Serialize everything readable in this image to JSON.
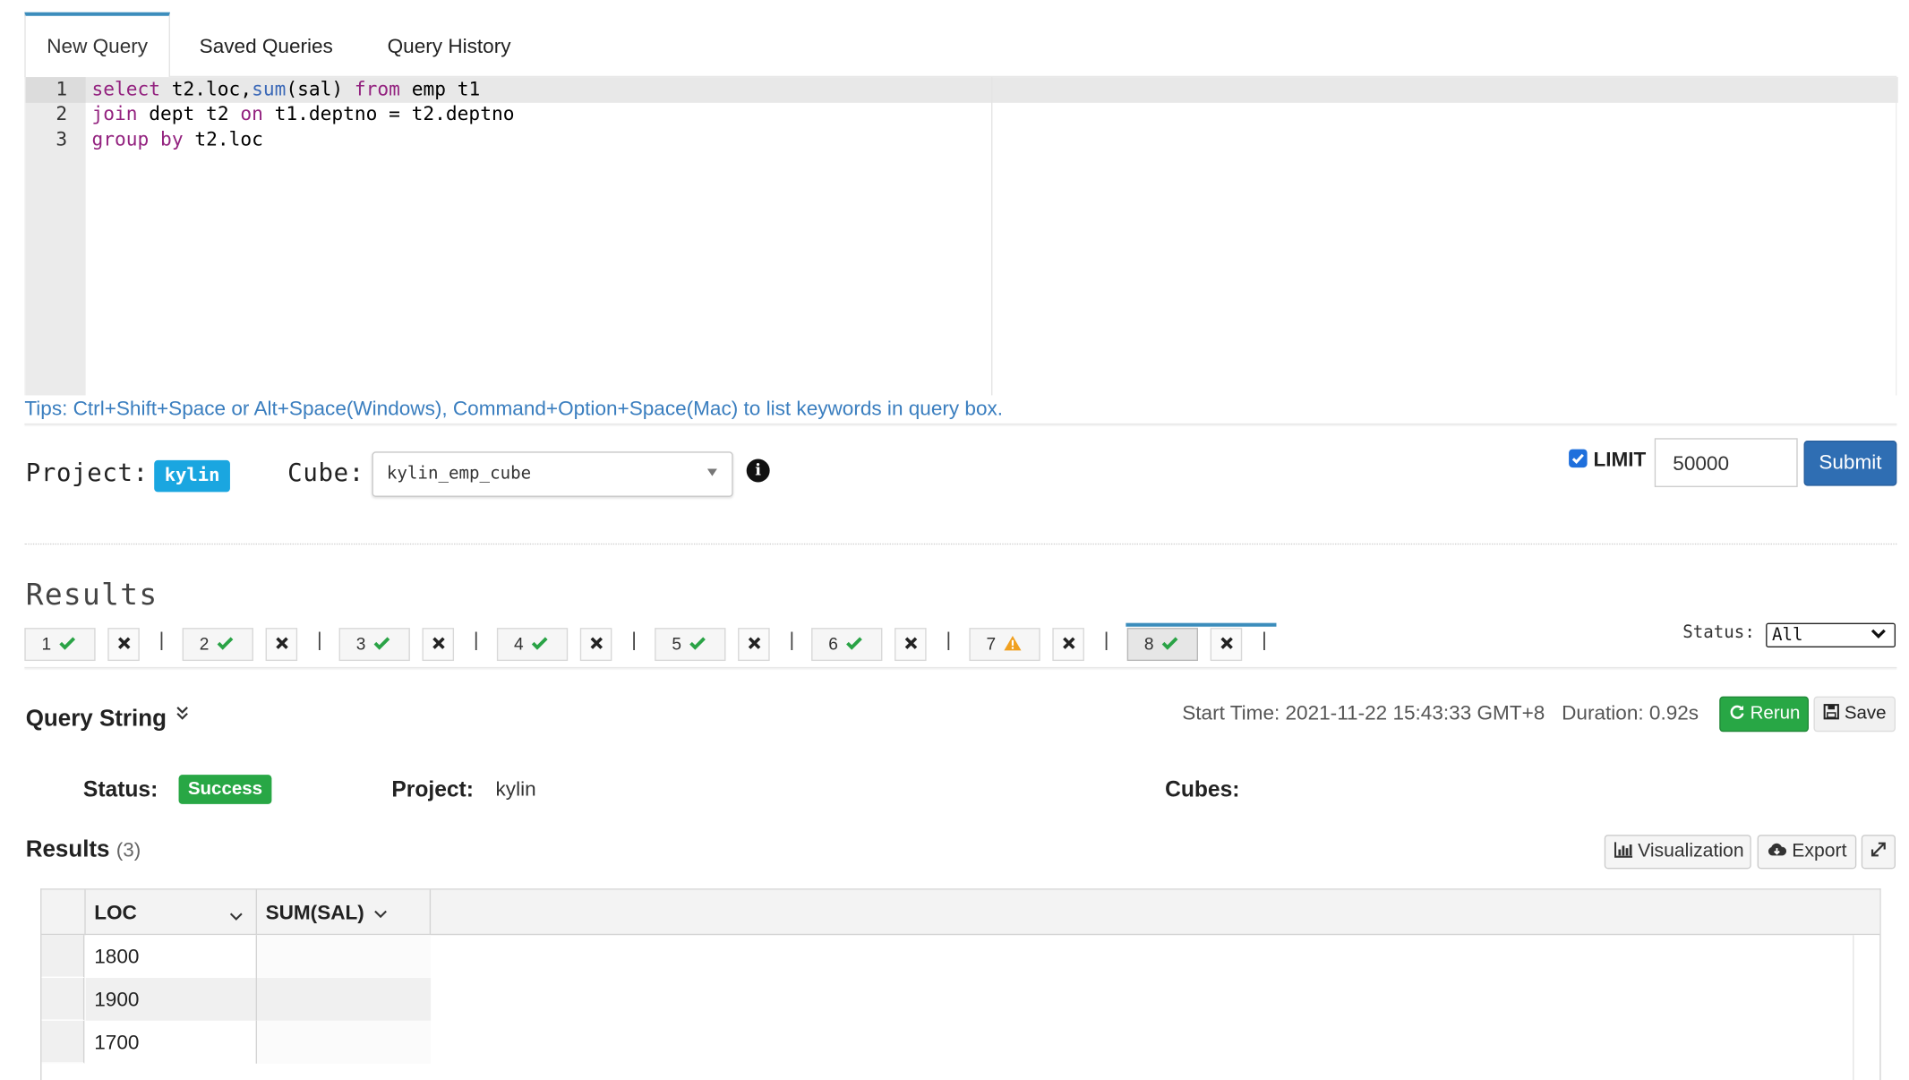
{
  "tabs": [
    {
      "label": "New Query",
      "active": true
    },
    {
      "label": "Saved Queries",
      "active": false
    },
    {
      "label": "Query History",
      "active": false
    }
  ],
  "editor": {
    "line_numbers": [
      "1",
      "2",
      "3"
    ],
    "lines": [
      "select t2.loc,sum(sal) from emp t1",
      "join dept t2 on t1.deptno = t2.deptno",
      "group by t2.loc"
    ]
  },
  "tips": "Tips: Ctrl+Shift+Space or Alt+Space(Windows), Command+Option+Space(Mac) to list keywords in query box.",
  "project_row": {
    "project_label": "Project:",
    "project_value": "kylin",
    "cube_label": "Cube:",
    "cube_value": "kylin_emp_cube",
    "limit_checked": true,
    "limit_label": "LIMIT",
    "limit_value": "50000",
    "submit_label": "Submit"
  },
  "results_heading": "Results",
  "result_tabs": [
    {
      "num": "1",
      "status": "success"
    },
    {
      "num": "2",
      "status": "success"
    },
    {
      "num": "3",
      "status": "success"
    },
    {
      "num": "4",
      "status": "success"
    },
    {
      "num": "5",
      "status": "success"
    },
    {
      "num": "6",
      "status": "success"
    },
    {
      "num": "7",
      "status": "warning"
    },
    {
      "num": "8",
      "status": "success",
      "active": true
    }
  ],
  "status_filter": {
    "label": "Status:",
    "value": "All"
  },
  "query_string": {
    "title": "Query String",
    "start_time": "Start Time: 2021-11-22 15:43:33 GMT+8",
    "duration": "Duration: 0.92s",
    "rerun_label": "Rerun",
    "save_label": "Save"
  },
  "summary": {
    "status_label": "Status:",
    "status_value": "Success",
    "project_label": "Project:",
    "project_value": "kylin",
    "cubes_label": "Cubes:"
  },
  "results2": {
    "title": "Results",
    "count": "(3)",
    "visualization_label": "Visualization",
    "export_label": "Export"
  },
  "table": {
    "columns": [
      "LOC",
      "SUM(SAL)"
    ],
    "rows": [
      [
        "1800",
        ""
      ],
      [
        "1900",
        ""
      ],
      [
        "1700",
        ""
      ]
    ]
  },
  "colors": {
    "accent": "#3c8dbc",
    "primary_button": "#2f6eb3",
    "success": "#28a745",
    "badge_blue": "#1aa6e0",
    "link": "#3a7ebf",
    "warning": "#f0a020"
  }
}
